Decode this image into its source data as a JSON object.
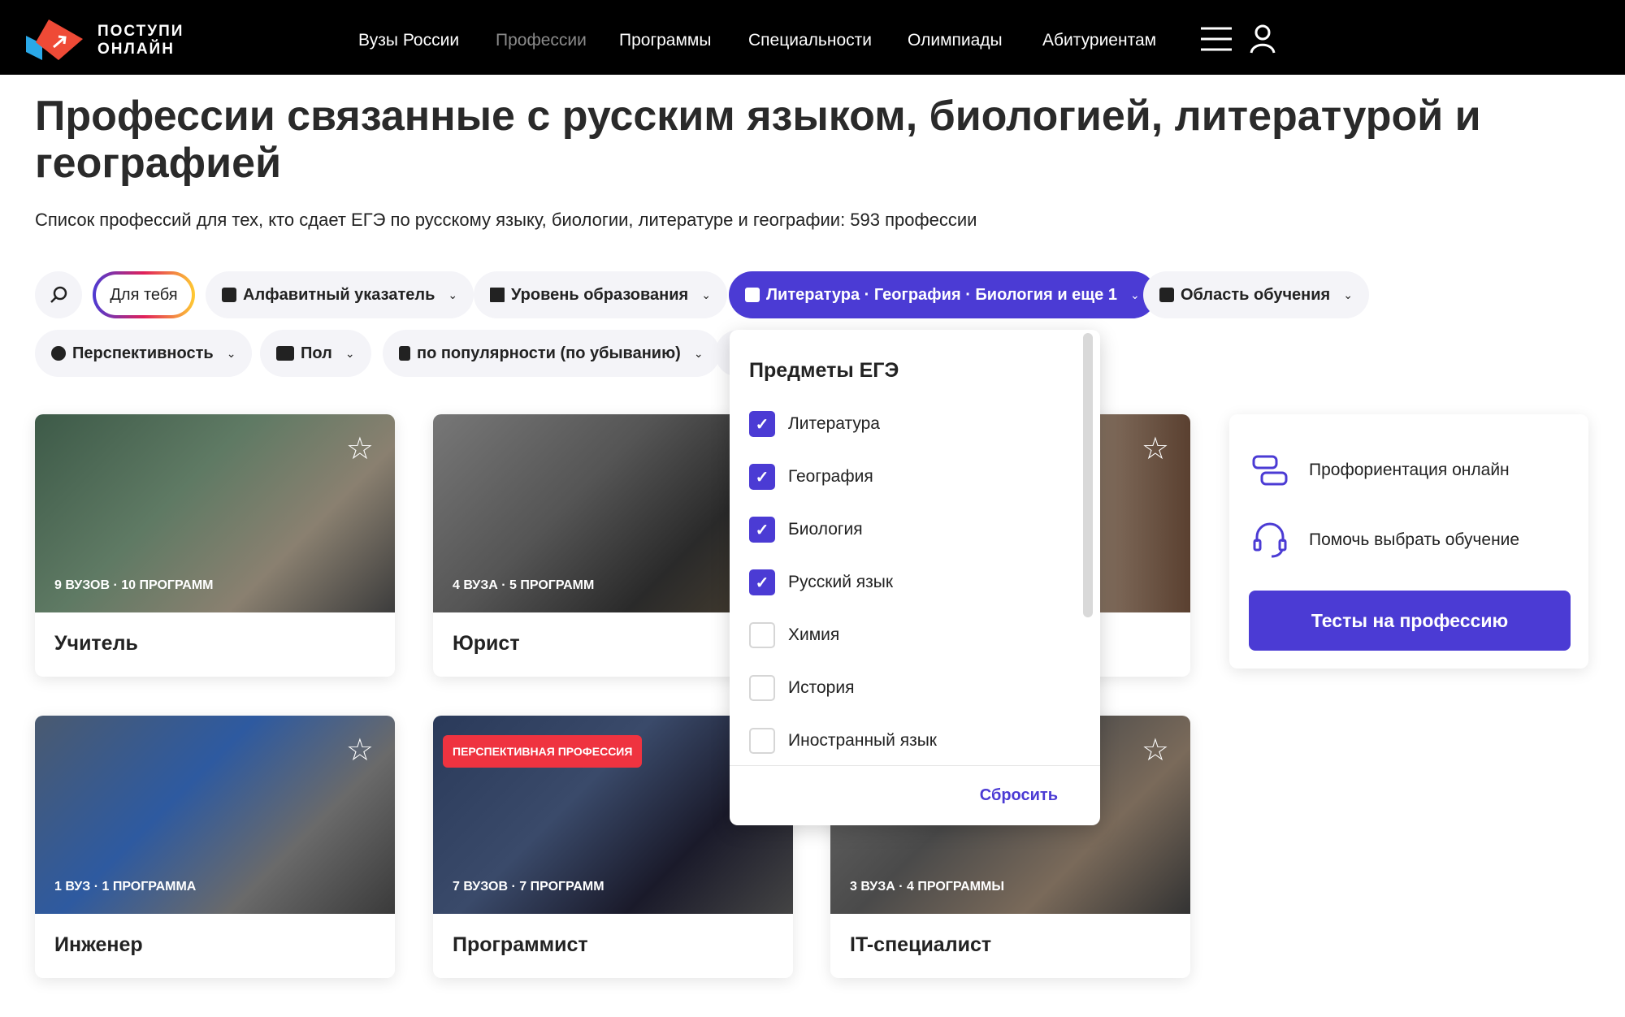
{
  "header": {
    "logo_line1": "ПОСТУПИ",
    "logo_line2": "ОНЛАЙН",
    "nav": [
      "Вузы России",
      "Профессии",
      "Программы",
      "Специальности",
      "Олимпиады",
      "Абитуриентам"
    ],
    "active_nav": "Профессии"
  },
  "page": {
    "title": "Профессии связанные с русским языком, биологией, литературой и географией",
    "subtitle": "Список профессий для тех, кто сдает ЕГЭ по русскому языку, биологии, литературе и географии: 593 профессии"
  },
  "filters": {
    "for_you": "Для тебя",
    "alphabet": "Алфавитный указатель",
    "level": "Уровень образования",
    "subjects": "Литература · География · Биология и еще 1",
    "field": "Область обучения",
    "prospects": "Перспективность",
    "gender": "Пол",
    "sort": "по популярности (по убыванию)"
  },
  "cards": [
    {
      "name": "Учитель",
      "meta": "9 ВУЗОВ  ·  10 ПРОГРАММ"
    },
    {
      "name": "Юрист",
      "meta": "4 ВУЗА  ·  5 ПРОГРАММ"
    },
    {
      "name": "",
      "meta": ""
    },
    {
      "name": "Инженер",
      "meta": "1 ВУЗ  ·  1 ПРОГРАММА"
    },
    {
      "name": "Программист",
      "meta": "7 ВУЗОВ  ·  7 ПРОГРАММ",
      "badge": "ПЕРСПЕКТИВНАЯ ПРОФЕССИЯ"
    },
    {
      "name": "IT-специалист",
      "meta": "3 ВУЗА  ·  4 ПРОГРАММЫ"
    }
  ],
  "panel": {
    "item1": "Профориентация онлайн",
    "item2": "Помочь выбрать обучение",
    "button": "Тесты на профессию"
  },
  "dropdown": {
    "title": "Предметы ЕГЭ",
    "options": [
      {
        "label": "Литература",
        "checked": true
      },
      {
        "label": "География",
        "checked": true
      },
      {
        "label": "Биология",
        "checked": true
      },
      {
        "label": "Русский язык",
        "checked": true
      },
      {
        "label": "Химия",
        "checked": false
      },
      {
        "label": "История",
        "checked": false
      },
      {
        "label": "Иностранный язык",
        "checked": false
      }
    ],
    "reset": "Сбросить"
  },
  "colors": {
    "accent": "#4b3bd4",
    "badge": "#ef3340",
    "header_bg": "#000000"
  }
}
